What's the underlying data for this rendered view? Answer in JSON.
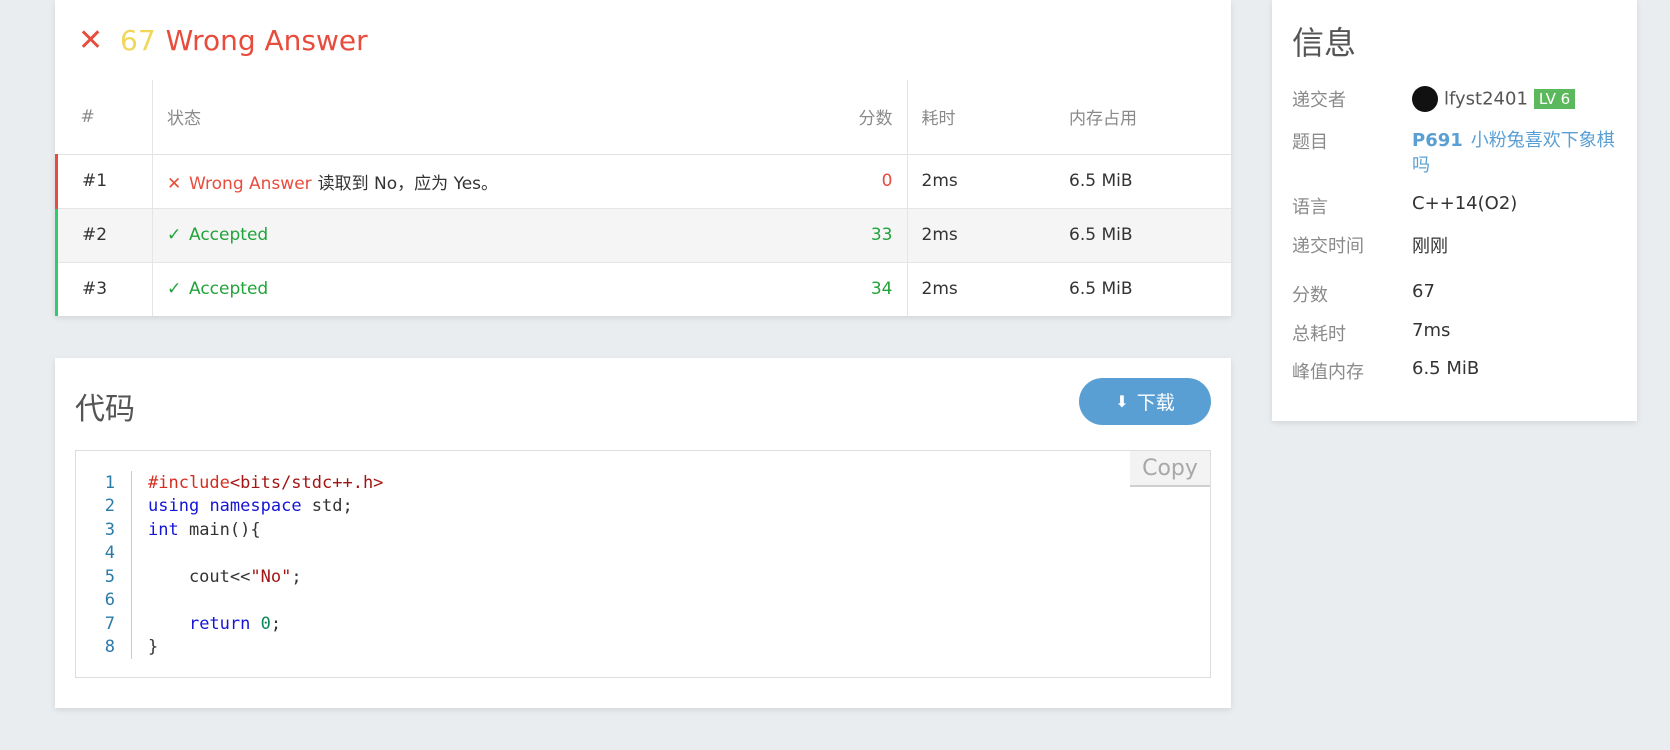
{
  "result": {
    "icon": "close-icon",
    "score": "67",
    "status": "Wrong Answer",
    "columns": {
      "num": "#",
      "status": "状态",
      "score": "分数",
      "time": "耗时",
      "memory": "内存占用"
    },
    "cases": [
      {
        "num": "#1",
        "status": "Wrong Answer",
        "message": "读取到 No，应为 Yes。",
        "score": "0",
        "time": "2ms",
        "memory": "6.5 MiB"
      },
      {
        "num": "#2",
        "status": "Accepted",
        "message": "",
        "score": "33",
        "time": "2ms",
        "memory": "6.5 MiB"
      },
      {
        "num": "#3",
        "status": "Accepted",
        "message": "",
        "score": "34",
        "time": "2ms",
        "memory": "6.5 MiB"
      }
    ]
  },
  "code": {
    "title": "代码",
    "download_label": "下载",
    "copy_label": "Copy",
    "line_numbers": [
      "1",
      "2",
      "3",
      "4",
      "5",
      "6",
      "7",
      "8"
    ]
  },
  "info": {
    "title": "信息",
    "submitter_label": "递交者",
    "submitter_name": "lfyst2401",
    "submitter_level": "LV 6",
    "problem_label": "题目",
    "problem_id": "P691",
    "problem_name": "小粉兔喜欢下象棋吗",
    "language_label": "语言",
    "language": "C++14(O2)",
    "submit_time_label": "递交时间",
    "submit_time": "刚刚",
    "score_label": "分数",
    "score": "67",
    "total_time_label": "总耗时",
    "total_time": "7ms",
    "peak_memory_label": "峰值内存",
    "peak_memory": "6.5 MiB"
  },
  "colors": {
    "wrong": "#e74c3c",
    "accepted": "#21a33b",
    "score_yellow": "#f0d75a",
    "primary": "#5a9fd4"
  }
}
